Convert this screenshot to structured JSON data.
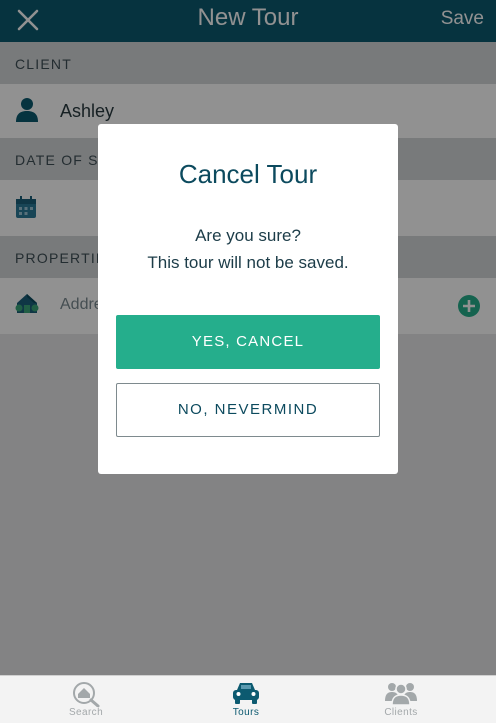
{
  "header": {
    "title": "New Tour",
    "save_label": "Save"
  },
  "client_section": {
    "label": "CLIENT",
    "value": "Ashley"
  },
  "date_section": {
    "label": "DATE OF SHOWING",
    "value": ""
  },
  "properties_section": {
    "label": "PROPERTIES",
    "address_placeholder": "Address"
  },
  "dialog": {
    "title": "Cancel Tour",
    "message_line1": "Are you sure?",
    "message_line2": "This tour will not be saved.",
    "confirm_label": "YES, CANCEL",
    "dismiss_label": "NO, NEVERMIND"
  },
  "tabbar": {
    "tabs": [
      {
        "label": "Search",
        "icon": "search-house-icon",
        "active": false
      },
      {
        "label": "Tours",
        "icon": "car-icon",
        "active": true
      },
      {
        "label": "Clients",
        "icon": "people-icon",
        "active": false
      }
    ]
  },
  "colors": {
    "header_bg": "#0c5a70",
    "accent_green": "#25ae8c",
    "tab_active": "#0c5a70",
    "tab_inactive": "#a3a8aa"
  }
}
